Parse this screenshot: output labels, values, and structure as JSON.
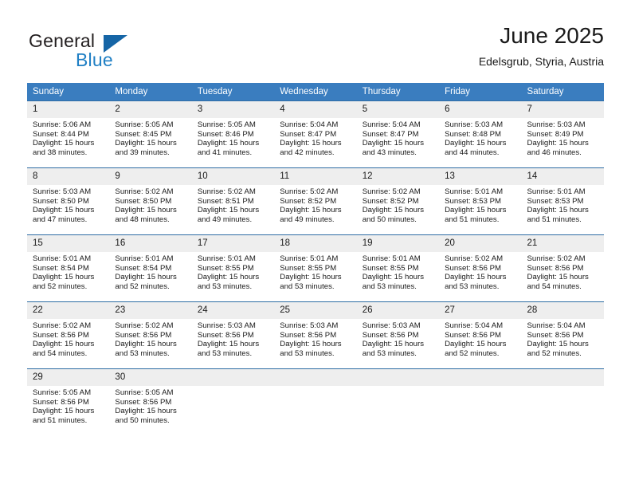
{
  "logo": {
    "word_top": "General",
    "word_bottom": "Blue",
    "triangle_color": "#1565a6",
    "blue_color": "#1f7fc4"
  },
  "header": {
    "title": "June 2025",
    "subtitle": "Edelsgrub, Styria, Austria"
  },
  "theme": {
    "header_bg": "#3a7dbf",
    "row_rule": "#2e6da4",
    "daynum_bg": "#eeeeee"
  },
  "weekday_headers": [
    "Sunday",
    "Monday",
    "Tuesday",
    "Wednesday",
    "Thursday",
    "Friday",
    "Saturday"
  ],
  "weeks": [
    {
      "days": [
        {
          "num": "1",
          "sunrise": "Sunrise: 5:06 AM",
          "sunset": "Sunset: 8:44 PM",
          "daylight1": "Daylight: 15 hours",
          "daylight2": "and 38 minutes."
        },
        {
          "num": "2",
          "sunrise": "Sunrise: 5:05 AM",
          "sunset": "Sunset: 8:45 PM",
          "daylight1": "Daylight: 15 hours",
          "daylight2": "and 39 minutes."
        },
        {
          "num": "3",
          "sunrise": "Sunrise: 5:05 AM",
          "sunset": "Sunset: 8:46 PM",
          "daylight1": "Daylight: 15 hours",
          "daylight2": "and 41 minutes."
        },
        {
          "num": "4",
          "sunrise": "Sunrise: 5:04 AM",
          "sunset": "Sunset: 8:47 PM",
          "daylight1": "Daylight: 15 hours",
          "daylight2": "and 42 minutes."
        },
        {
          "num": "5",
          "sunrise": "Sunrise: 5:04 AM",
          "sunset": "Sunset: 8:47 PM",
          "daylight1": "Daylight: 15 hours",
          "daylight2": "and 43 minutes."
        },
        {
          "num": "6",
          "sunrise": "Sunrise: 5:03 AM",
          "sunset": "Sunset: 8:48 PM",
          "daylight1": "Daylight: 15 hours",
          "daylight2": "and 44 minutes."
        },
        {
          "num": "7",
          "sunrise": "Sunrise: 5:03 AM",
          "sunset": "Sunset: 8:49 PM",
          "daylight1": "Daylight: 15 hours",
          "daylight2": "and 46 minutes."
        }
      ]
    },
    {
      "days": [
        {
          "num": "8",
          "sunrise": "Sunrise: 5:03 AM",
          "sunset": "Sunset: 8:50 PM",
          "daylight1": "Daylight: 15 hours",
          "daylight2": "and 47 minutes."
        },
        {
          "num": "9",
          "sunrise": "Sunrise: 5:02 AM",
          "sunset": "Sunset: 8:50 PM",
          "daylight1": "Daylight: 15 hours",
          "daylight2": "and 48 minutes."
        },
        {
          "num": "10",
          "sunrise": "Sunrise: 5:02 AM",
          "sunset": "Sunset: 8:51 PM",
          "daylight1": "Daylight: 15 hours",
          "daylight2": "and 49 minutes."
        },
        {
          "num": "11",
          "sunrise": "Sunrise: 5:02 AM",
          "sunset": "Sunset: 8:52 PM",
          "daylight1": "Daylight: 15 hours",
          "daylight2": "and 49 minutes."
        },
        {
          "num": "12",
          "sunrise": "Sunrise: 5:02 AM",
          "sunset": "Sunset: 8:52 PM",
          "daylight1": "Daylight: 15 hours",
          "daylight2": "and 50 minutes."
        },
        {
          "num": "13",
          "sunrise": "Sunrise: 5:01 AM",
          "sunset": "Sunset: 8:53 PM",
          "daylight1": "Daylight: 15 hours",
          "daylight2": "and 51 minutes."
        },
        {
          "num": "14",
          "sunrise": "Sunrise: 5:01 AM",
          "sunset": "Sunset: 8:53 PM",
          "daylight1": "Daylight: 15 hours",
          "daylight2": "and 51 minutes."
        }
      ]
    },
    {
      "days": [
        {
          "num": "15",
          "sunrise": "Sunrise: 5:01 AM",
          "sunset": "Sunset: 8:54 PM",
          "daylight1": "Daylight: 15 hours",
          "daylight2": "and 52 minutes."
        },
        {
          "num": "16",
          "sunrise": "Sunrise: 5:01 AM",
          "sunset": "Sunset: 8:54 PM",
          "daylight1": "Daylight: 15 hours",
          "daylight2": "and 52 minutes."
        },
        {
          "num": "17",
          "sunrise": "Sunrise: 5:01 AM",
          "sunset": "Sunset: 8:55 PM",
          "daylight1": "Daylight: 15 hours",
          "daylight2": "and 53 minutes."
        },
        {
          "num": "18",
          "sunrise": "Sunrise: 5:01 AM",
          "sunset": "Sunset: 8:55 PM",
          "daylight1": "Daylight: 15 hours",
          "daylight2": "and 53 minutes."
        },
        {
          "num": "19",
          "sunrise": "Sunrise: 5:01 AM",
          "sunset": "Sunset: 8:55 PM",
          "daylight1": "Daylight: 15 hours",
          "daylight2": "and 53 minutes."
        },
        {
          "num": "20",
          "sunrise": "Sunrise: 5:02 AM",
          "sunset": "Sunset: 8:56 PM",
          "daylight1": "Daylight: 15 hours",
          "daylight2": "and 53 minutes."
        },
        {
          "num": "21",
          "sunrise": "Sunrise: 5:02 AM",
          "sunset": "Sunset: 8:56 PM",
          "daylight1": "Daylight: 15 hours",
          "daylight2": "and 54 minutes."
        }
      ]
    },
    {
      "days": [
        {
          "num": "22",
          "sunrise": "Sunrise: 5:02 AM",
          "sunset": "Sunset: 8:56 PM",
          "daylight1": "Daylight: 15 hours",
          "daylight2": "and 54 minutes."
        },
        {
          "num": "23",
          "sunrise": "Sunrise: 5:02 AM",
          "sunset": "Sunset: 8:56 PM",
          "daylight1": "Daylight: 15 hours",
          "daylight2": "and 53 minutes."
        },
        {
          "num": "24",
          "sunrise": "Sunrise: 5:03 AM",
          "sunset": "Sunset: 8:56 PM",
          "daylight1": "Daylight: 15 hours",
          "daylight2": "and 53 minutes."
        },
        {
          "num": "25",
          "sunrise": "Sunrise: 5:03 AM",
          "sunset": "Sunset: 8:56 PM",
          "daylight1": "Daylight: 15 hours",
          "daylight2": "and 53 minutes."
        },
        {
          "num": "26",
          "sunrise": "Sunrise: 5:03 AM",
          "sunset": "Sunset: 8:56 PM",
          "daylight1": "Daylight: 15 hours",
          "daylight2": "and 53 minutes."
        },
        {
          "num": "27",
          "sunrise": "Sunrise: 5:04 AM",
          "sunset": "Sunset: 8:56 PM",
          "daylight1": "Daylight: 15 hours",
          "daylight2": "and 52 minutes."
        },
        {
          "num": "28",
          "sunrise": "Sunrise: 5:04 AM",
          "sunset": "Sunset: 8:56 PM",
          "daylight1": "Daylight: 15 hours",
          "daylight2": "and 52 minutes."
        }
      ]
    },
    {
      "days": [
        {
          "num": "29",
          "sunrise": "Sunrise: 5:05 AM",
          "sunset": "Sunset: 8:56 PM",
          "daylight1": "Daylight: 15 hours",
          "daylight2": "and 51 minutes."
        },
        {
          "num": "30",
          "sunrise": "Sunrise: 5:05 AM",
          "sunset": "Sunset: 8:56 PM",
          "daylight1": "Daylight: 15 hours",
          "daylight2": "and 50 minutes."
        },
        {
          "num": "",
          "sunrise": "",
          "sunset": "",
          "daylight1": "",
          "daylight2": ""
        },
        {
          "num": "",
          "sunrise": "",
          "sunset": "",
          "daylight1": "",
          "daylight2": ""
        },
        {
          "num": "",
          "sunrise": "",
          "sunset": "",
          "daylight1": "",
          "daylight2": ""
        },
        {
          "num": "",
          "sunrise": "",
          "sunset": "",
          "daylight1": "",
          "daylight2": ""
        },
        {
          "num": "",
          "sunrise": "",
          "sunset": "",
          "daylight1": "",
          "daylight2": ""
        }
      ]
    }
  ]
}
